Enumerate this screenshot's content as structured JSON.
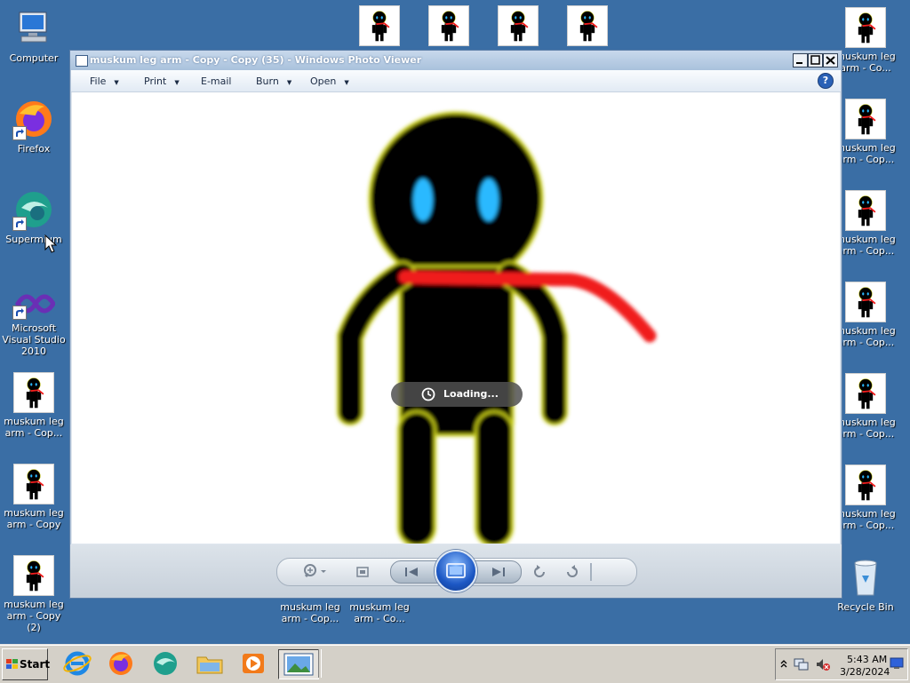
{
  "desktop": {
    "icons_left": [
      {
        "label": "Computer"
      },
      {
        "label": "Firefox"
      },
      {
        "label": "Supermium"
      },
      {
        "label": "Microsoft Visual Studio 2010"
      },
      {
        "label": "muskum leg arm - Cop..."
      },
      {
        "label": "muskum leg arm - Copy"
      },
      {
        "label": "muskum leg arm - Copy (2)"
      }
    ],
    "icons_right": [
      {
        "label": "muskum leg arm - Co..."
      },
      {
        "label": "muskum leg arm - Cop..."
      },
      {
        "label": "muskum leg arm - Cop..."
      },
      {
        "label": "muskum leg arm - Cop..."
      },
      {
        "label": "muskum leg arm - Cop..."
      },
      {
        "label": "muskum leg arm - Cop..."
      },
      {
        "label": "Recycle Bin"
      }
    ],
    "icons_bottom": [
      {
        "label": "muskum leg arm - Cop..."
      },
      {
        "label": "muskum leg arm - Co..."
      }
    ]
  },
  "window": {
    "title": "muskum leg arm - Copy - Copy (35) - Windows Photo Viewer",
    "menu": {
      "file": "File",
      "print": "Print",
      "email": "E-mail",
      "burn": "Burn",
      "open": "Open",
      "help": "?"
    },
    "loading_text": "Loading..."
  },
  "taskbar": {
    "start_label": "Start",
    "time": "5:43 AM",
    "date": "3/28/2024"
  },
  "colors": {
    "desktop_bg": "#3a6ea5",
    "scarf": "#f01c1c",
    "eyes": "#2ab9ff"
  }
}
